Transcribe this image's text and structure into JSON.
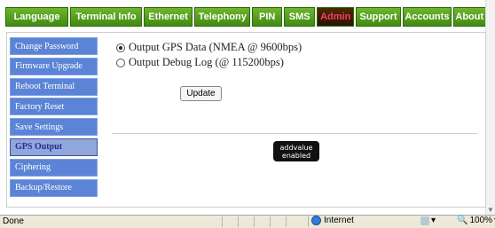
{
  "nav": {
    "tabs": [
      {
        "label": "Language"
      },
      {
        "label": "Terminal Info"
      },
      {
        "label": "Ethernet"
      },
      {
        "label": "Telephony"
      },
      {
        "label": "PIN"
      },
      {
        "label": "SMS"
      },
      {
        "label": "Admin"
      },
      {
        "label": "Support"
      },
      {
        "label": "Accounts"
      },
      {
        "label": "About"
      }
    ],
    "active": "Admin"
  },
  "sidebar": {
    "items": [
      {
        "label": "Change Password"
      },
      {
        "label": "Firmware Upgrade"
      },
      {
        "label": "Reboot Terminal"
      },
      {
        "label": "Factory Reset"
      },
      {
        "label": "Save Settings"
      },
      {
        "label": "GPS Output"
      },
      {
        "label": "Ciphering"
      },
      {
        "label": "Backup/Restore"
      }
    ],
    "active": "GPS Output"
  },
  "gps_output": {
    "options": [
      {
        "label": "Output GPS Data (NMEA @ 9600bps)",
        "selected": true
      },
      {
        "label": "Output Debug Log (@ 115200bps)",
        "selected": false
      }
    ],
    "update_label": "Update"
  },
  "logo": {
    "line1": "addvalue",
    "line2": "enabled"
  },
  "statusbar": {
    "status": "Done",
    "zone": "Internet",
    "zoom": "100%"
  },
  "colors": {
    "tab_green": "#4f9e1c",
    "tab_active_bg": "#3a1e00",
    "tab_active_text": "#ff3a6a",
    "sidebar_blue": "#5b84d6",
    "sidebar_active_bg": "#8fa7dd"
  }
}
